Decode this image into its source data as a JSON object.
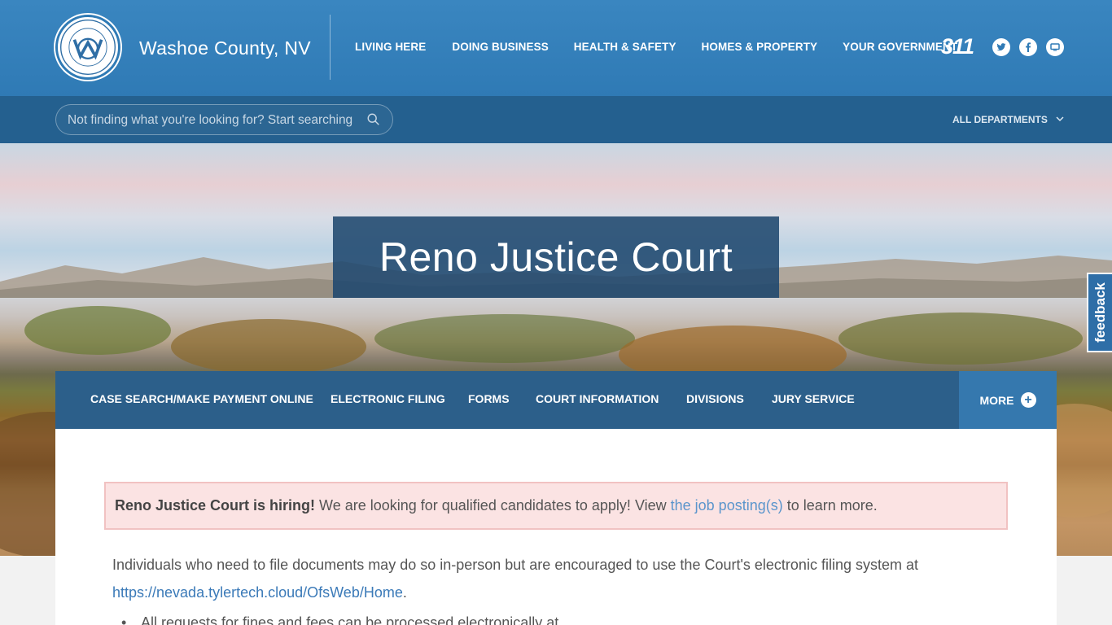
{
  "header": {
    "county_name": "Washoe County, NV",
    "seal_text_top": "WASHOE COUNTY, NEVADA",
    "seal_year": "1861",
    "nav": [
      "LIVING HERE",
      "DOING BUSINESS",
      "HEALTH & SAFETY",
      "HOMES & PROPERTY",
      "YOUR GOVERNMENT"
    ],
    "logo_311": "311",
    "social_icons": [
      "twitter-icon",
      "facebook-icon",
      "screen-icon"
    ],
    "colors": {
      "primary": "#2f7ab5",
      "band": "#24608f"
    }
  },
  "search": {
    "placeholder": "Not finding what you're looking for? Start searching",
    "all_departments_label": "ALL DEPARTMENTS"
  },
  "hero": {
    "title": "Reno Justice Court"
  },
  "feedback": {
    "label": "feedback"
  },
  "dept_nav": {
    "items": [
      "CASE SEARCH/MAKE PAYMENT ONLINE",
      "ELECTRONIC FILING",
      "FORMS",
      "COURT INFORMATION",
      "DIVISIONS",
      "JURY SERVICE"
    ],
    "more_label": "MORE"
  },
  "content": {
    "alert_bold": "Reno Justice Court is hiring!",
    "alert_text": " We are looking for qualified candidates to apply! View ",
    "alert_link": "the job posting(s)",
    "alert_tail": " to learn more.",
    "paragraph": "Individuals who need to file documents may do so in-person but are encouraged to use the Court's electronic filing system at ",
    "paragraph_link": "https://nevada.tylertech.cloud/OfsWeb/Home",
    "paragraph_tail": ".",
    "list_item_fragment": "All requests for fines and fees can be processed electronically at"
  }
}
